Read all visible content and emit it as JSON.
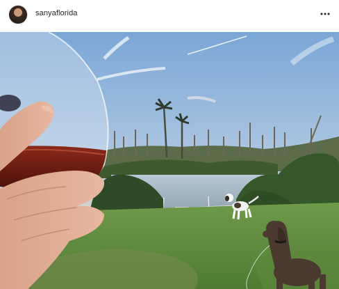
{
  "post": {
    "username": "sanyaflorida",
    "more_label": "More options"
  },
  "icons": {
    "avatar": "profile-photo",
    "more": "ellipsis-icon"
  },
  "colors": {
    "text": "#262626",
    "background": "#ffffff"
  }
}
